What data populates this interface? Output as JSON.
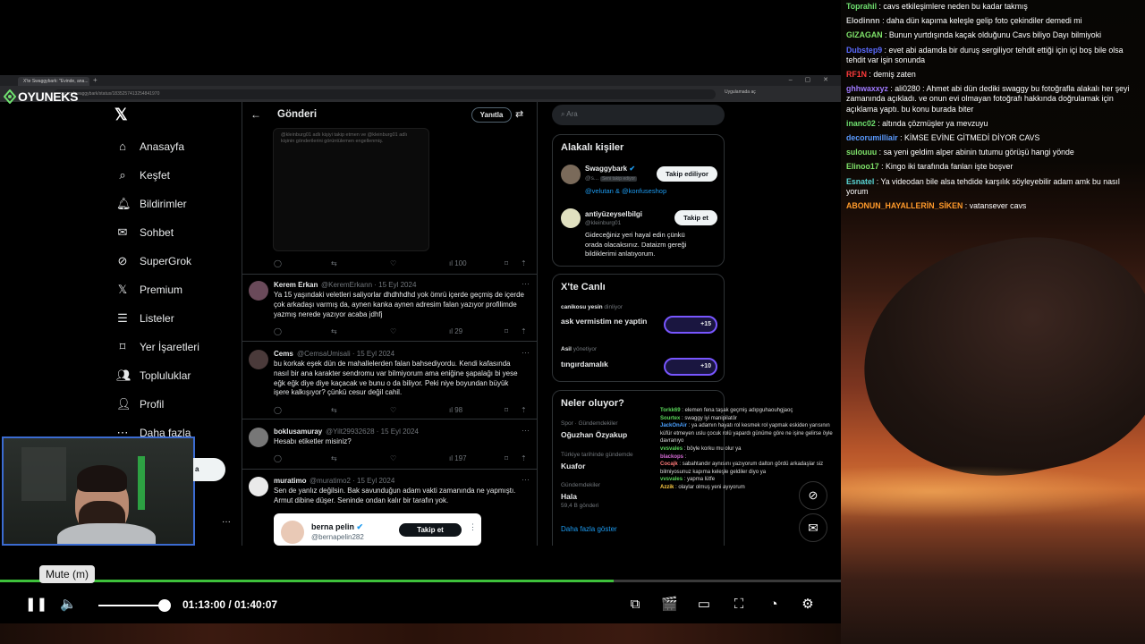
{
  "browser": {
    "tab_title": "X'te Swaggybark: \"Evinde, ana...",
    "url": "x.com/swaggybark/status/1835257413254841970",
    "url_right": "Uygulamada aç"
  },
  "logo": {
    "text": "OYUNEKS"
  },
  "x_nav": {
    "items": [
      {
        "label": "Anasayfa",
        "icon": "home-icon"
      },
      {
        "label": "Keşfet",
        "icon": "search-icon"
      },
      {
        "label": "Bildirimler",
        "icon": "bell-icon"
      },
      {
        "label": "Sohbet",
        "icon": "mail-icon"
      },
      {
        "label": "SuperGrok",
        "icon": "grok-icon"
      },
      {
        "label": "Premium",
        "icon": "x-icon"
      },
      {
        "label": "Listeler",
        "icon": "list-icon"
      },
      {
        "label": "Yer İşaretleri",
        "icon": "bookmark-icon"
      },
      {
        "label": "Topluluklar",
        "icon": "community-icon"
      },
      {
        "label": "Profil",
        "icon": "profile-icon"
      },
      {
        "label": "Daha fazla",
        "icon": "more-icon"
      }
    ],
    "post_button_fragment": "a"
  },
  "center": {
    "title": "Gönderi",
    "reply_button": "Yanıtla",
    "media_caption": "@kleinburg01 adlı kişiyi takip etmen ve @kleinburg01 adlı kişinin gönderilerini görüntülemen engellenmiş.",
    "first_actions_views": "100",
    "posts": [
      {
        "name": "Kerem Erkan",
        "handle": "@KeremErkann · 15 Eyl 2024",
        "text": "Ya 15 yaşındaki veletleri saliyorlar dhdhhdhd yok ömrü içerde geçmiş de içerde çok arkadaşı varmış da, aynen kanka aynen adresim falan yazıyor profilimde yazmış nerede yazıyor acaba jdhfj",
        "views": "29"
      },
      {
        "name": "Cems",
        "handle": "@CemsaUmisali · 15 Eyl 2024",
        "text": "bu korkak eşek dün de mahallelerden falan bahsediyordu. Kendi kafasında nasıl bir ana karakter sendromu var bilmiyorum ama eniğine şapalağı bi yese eğk eğk diye diye kaçacak ve bunu o da biliyor. Peki niye boyundan büyük işere kalkışıyor? çünkü cesur değil cahil.",
        "views": "98"
      },
      {
        "name": "boklusamuray",
        "handle": "@Yilt29932628 · 15 Eyl 2024",
        "text": "Hesabı etiketler misiniz?",
        "views": "197"
      },
      {
        "name": "muratimo",
        "handle": "@muratimo2 · 15 Eyl 2024",
        "text": "Sen de yanlız değilsin. Bak savunduğun adam vakti zamanında ne yapmıştı. Armut dibine düşer. Seninde ondan kalır bir tarafın yok.",
        "views": ""
      }
    ],
    "embed": {
      "name": "berna pelin",
      "handle": "@bernapelin282",
      "follow": "Takip et"
    }
  },
  "right": {
    "search_placeholder": "Ara",
    "related": {
      "title": "Alakalı kişiler",
      "people": [
        {
          "name": "Swaggybark",
          "handle": "@s...",
          "badge": "Seni takip ediyor",
          "mentions": "@velutan & @konfuseshop",
          "button": "Takip ediliyor"
        },
        {
          "name": "antiyüzeyselbilgi",
          "handle": "@kleinburg01",
          "bio": "Gideceğiniz yeri hayal edin çünkü orada olacaksınız. Dataizm gereği bildiklerimi anlatıyorum.",
          "button": "Takip et"
        }
      ]
    },
    "live": {
      "title": "X'te Canlı",
      "spaces": [
        {
          "host": "canikosu yesin",
          "status": "dinliyor",
          "topic": "ask vermistim ne yaptin",
          "count": "+15"
        },
        {
          "host": "Asil",
          "status": "yönetiyor",
          "topic": "tıngırdamalık",
          "count": "+10"
        }
      ]
    },
    "trends": {
      "title": "Neler oluyor?",
      "items": [
        {
          "context": "Spor · Gündemdekiler",
          "name": "Oğuzhan Özyakup",
          "meta": ""
        },
        {
          "context": "Türkiye tarihinde gündemde",
          "name": "Kuafor",
          "meta": ""
        },
        {
          "context": "Gündemdekiler",
          "name": "Hala",
          "meta": "59,4 B gönderi"
        }
      ],
      "more": "Daha fazla göster"
    }
  },
  "overlay_chat": [
    {
      "user": "Torkk69",
      "color": "#5ad65a",
      "text": "elemen fena taşak geçmiş adıpguhaouhgjaoç"
    },
    {
      "user": "Sourtex",
      "color": "#5ad65a",
      "text": "swaggy iyi manipilatör"
    },
    {
      "user": "JackOnAir",
      "color": "#4aa0ff",
      "text": "ya adamın hayatı rol kesmek rol yapmak eskiden yarısının küfür etmeyen uslu çocuk rolü yapardı günüme göre ne işine gelirse öyle davranıyo"
    },
    {
      "user": "vvsvales",
      "color": "#5ad65a",
      "text": "böyle korku mu olur ya"
    },
    {
      "user": "blackops",
      "color": "#d66ad6",
      "text": ""
    },
    {
      "user": "Cocajk",
      "color": "#ff7a7a",
      "text": "sabahtandır aynısını yazıyorum dalton gördü arkadaşlar siz bilmiyosunuz kapıma keleşle geldiler diyo ya"
    },
    {
      "user": "vvsvales",
      "color": "#5ad65a",
      "text": "yapma lütfe"
    },
    {
      "user": "Azzik",
      "color": "#ffcc44",
      "text": "olaylar olmuş yeni ayıyorum"
    }
  ],
  "player": {
    "tooltip": "Mute (m)",
    "time": "01:13:00 / 01:40:07",
    "progress": 0.73,
    "volume": 0.92
  },
  "chat": [
    {
      "user": "Toprahil",
      "color": "#6fe06f",
      "text": "cavs etkileşimlere neden bu kadar takmış"
    },
    {
      "user": "Elodinnn",
      "color": "#c9c9c9",
      "text": "daha dün kapıma keleşle gelip foto çekindiler demedi mi"
    },
    {
      "user": "GIZAGAN",
      "color": "#7fe36a",
      "text": "Bunun yurtdışında kaçak olduğunu Cavs biliyo Dayı bilmiyoki"
    },
    {
      "user": "Dubstep9",
      "color": "#5b6bff",
      "text": "evet abi adamda bir duruş sergiliyor tehdit ettiği için içi boş bile olsa tehdit var işin sonunda"
    },
    {
      "user": "RF1N",
      "color": "#ff3b3b",
      "text": "demiş zaten"
    },
    {
      "user": "ghhwaxxyz",
      "color": "#a07aff",
      "text": "ali0280 : Ahmet abi dün dediki swaggy bu fotoğrafla alakalı her şeyi zamanında açıkladı. ve onun evi olmayan fotoğrafı hakkında doğrulamak için açıklama yaptı. bu konu burada biter"
    },
    {
      "user": "inanc02",
      "color": "#6fe06f",
      "text": "altında çözmüşler ya mevzuyu"
    },
    {
      "user": "decorumilliair",
      "color": "#5b9bff",
      "text": "KİMSE EVİNE GİTMEDİ DİYOR CAVS"
    },
    {
      "user": "sulouuu",
      "color": "#7fe36a",
      "text": "sa yeni geldim alper abinin tutumu görüşü hangi yönde"
    },
    {
      "user": "Elinoo17",
      "color": "#7fe36a",
      "text": "Kingo iki tarafında fanları işte boşver"
    },
    {
      "user": "Esnatel",
      "color": "#5ad6d6",
      "text": "Ya videodan bile alsa tehdide karşılık söyleyebilir adam amk bu nasıl yorum"
    },
    {
      "user": "ABONUN_HAYALLERİN_SİKEN",
      "color": "#ff9a2a",
      "text": "vatansever cavs"
    }
  ]
}
